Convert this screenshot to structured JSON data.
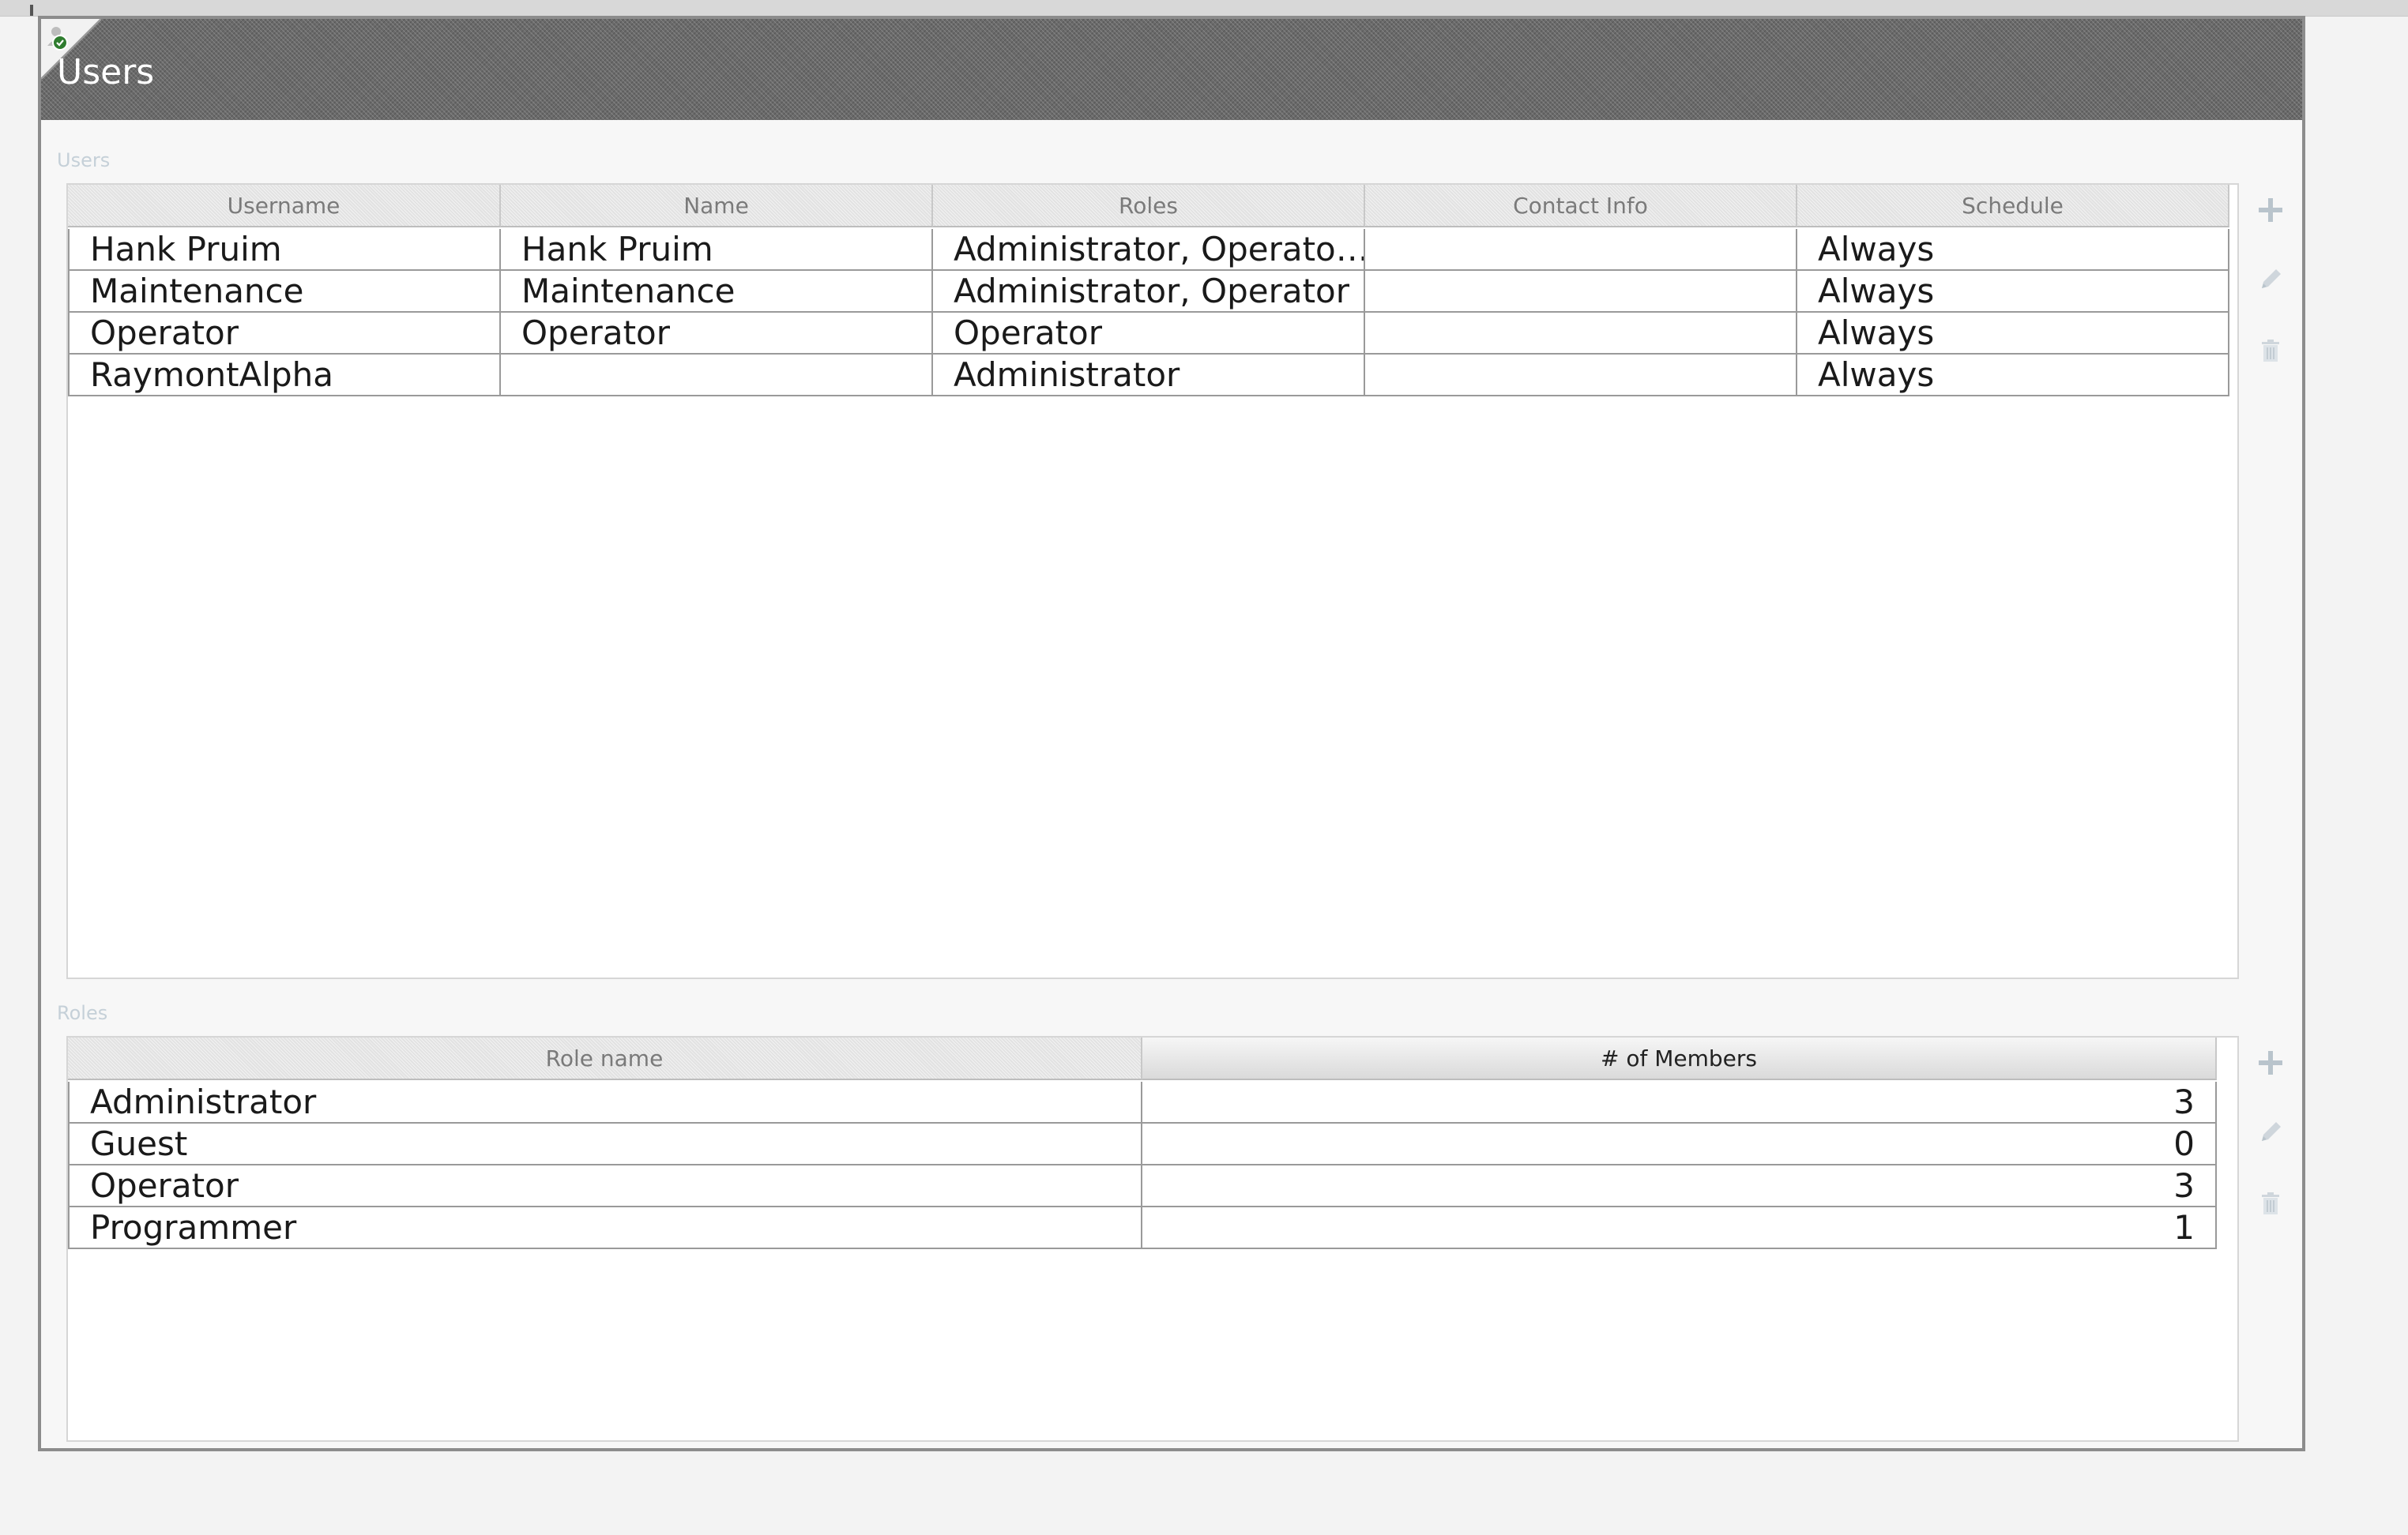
{
  "window": {
    "title": "Users"
  },
  "users_section": {
    "label": "Users",
    "columns": [
      "Username",
      "Name",
      "Roles",
      "Contact Info",
      "Schedule"
    ],
    "rows": [
      [
        "Hank Pruim",
        "Hank Pruim",
        "Administrator, Operato…",
        "",
        "Always"
      ],
      [
        "Maintenance",
        "Maintenance",
        "Administrator, Operator",
        "",
        "Always"
      ],
      [
        "Operator",
        "Operator",
        "Operator",
        "",
        "Always"
      ],
      [
        "RaymontAlpha",
        "",
        "Administrator",
        "",
        "Always"
      ]
    ],
    "actions": [
      "plus-icon",
      "pencil-icon",
      "trash-icon"
    ]
  },
  "roles_section": {
    "label": "Roles",
    "columns": [
      "Role name",
      "# of Members"
    ],
    "sorted_column": "# of Members",
    "rows": [
      [
        "Administrator",
        "3"
      ],
      [
        "Guest",
        "0"
      ],
      [
        "Operator",
        "3"
      ],
      [
        "Programmer",
        "1"
      ]
    ],
    "actions": [
      "plus-icon",
      "pencil-icon",
      "trash-icon"
    ]
  },
  "colors": {
    "title_bar": "#6a6a6a",
    "disabled_icon": "#b9c4cc",
    "section_label": "#c5d0d8"
  }
}
